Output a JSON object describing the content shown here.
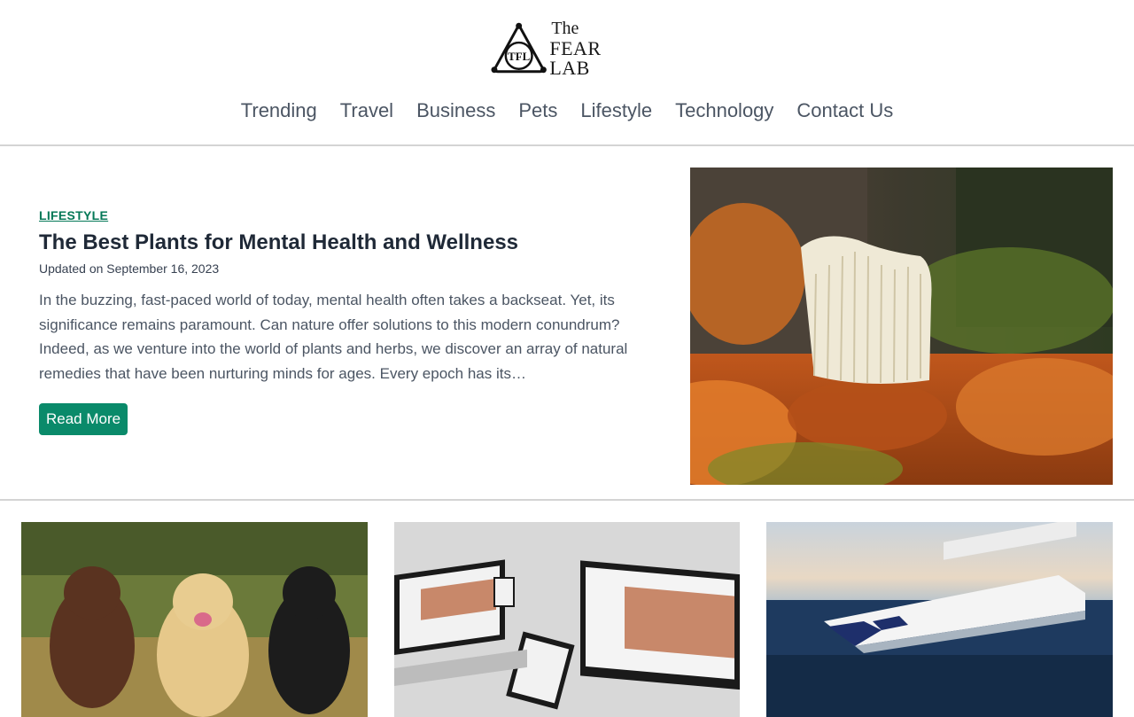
{
  "site": {
    "logo_line1": "The",
    "logo_line2": "FEAR LAB",
    "logo_monogram": "TFL"
  },
  "nav": {
    "items": [
      "Trending",
      "Travel",
      "Business",
      "Pets",
      "Lifestyle",
      "Technology",
      "Contact Us"
    ]
  },
  "featured": {
    "category": "LIFESTYLE",
    "title": "The Best Plants for Mental Health and Wellness",
    "date": "Updated on September 16, 2023",
    "excerpt": "In the buzzing, fast-paced world of today, mental health often takes a backseat. Yet, its significance remains paramount. Can nature offer solutions to this modern conundrum? Indeed, as we venture into the world of plants and herbs, we discover an array of natural remedies that have been nurturing minds for ages. Every epoch has its…",
    "read_more": "Read More"
  },
  "cards": [
    {
      "image": "dogs-image"
    },
    {
      "image": "devices-image"
    },
    {
      "image": "cruise-ship-image"
    }
  ],
  "colors": {
    "accent": "#0a8a6a",
    "category": "#047857",
    "nav_text": "#4b5563",
    "divider": "#d4d4d4"
  }
}
